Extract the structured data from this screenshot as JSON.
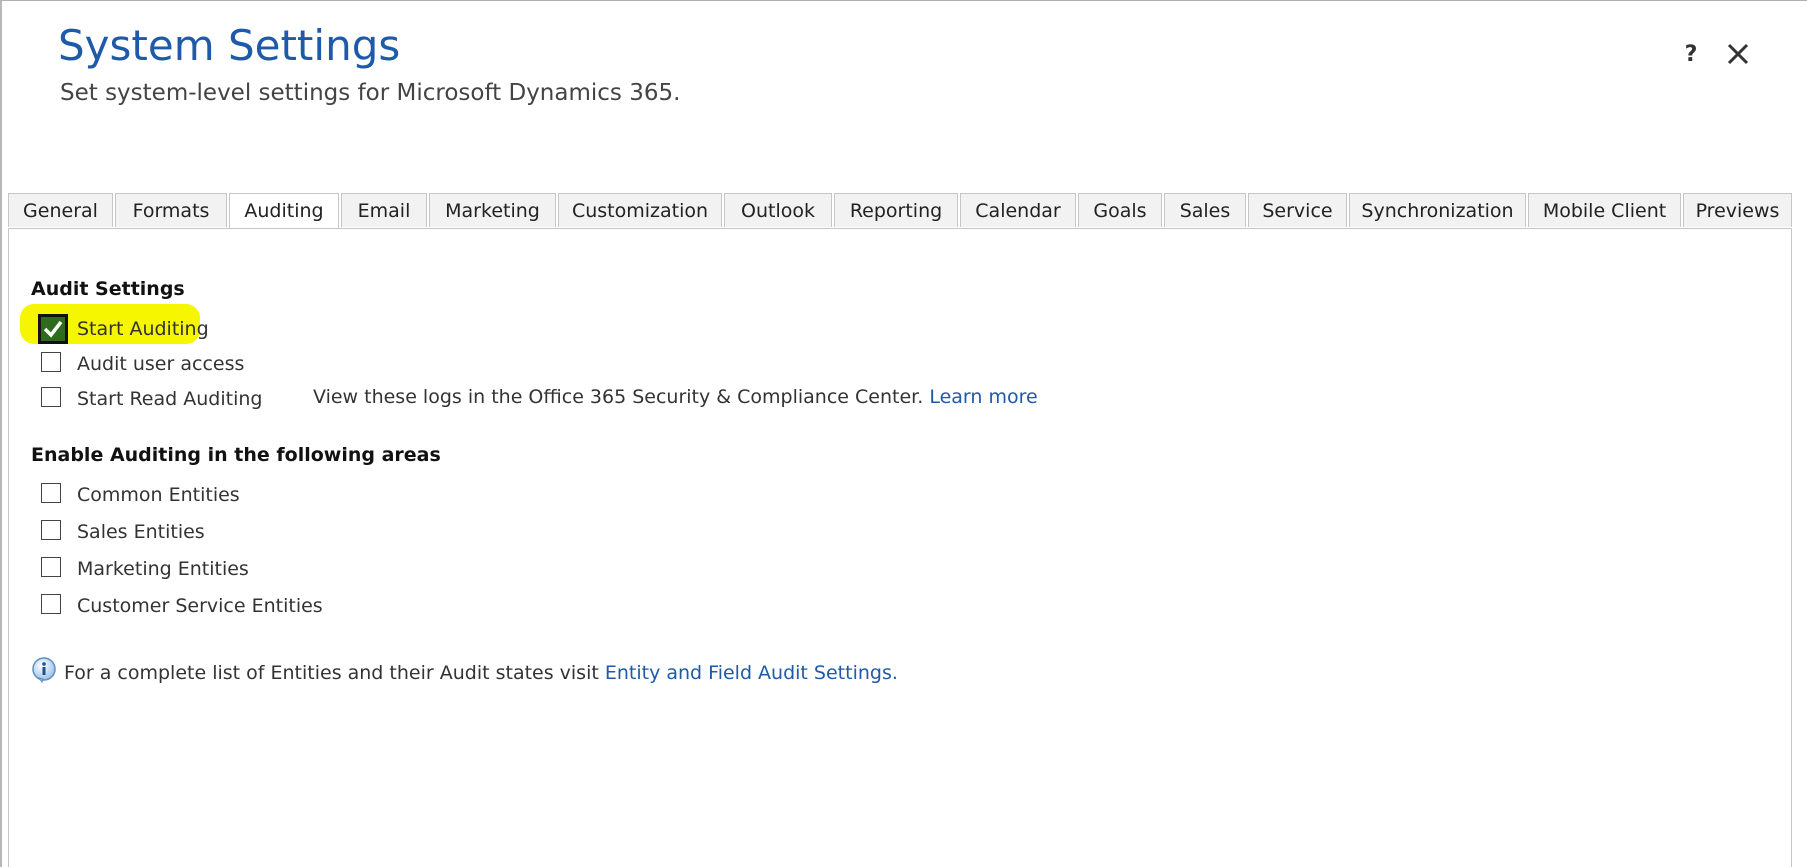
{
  "header": {
    "title": "System Settings",
    "subtitle": "Set system-level settings for Microsoft Dynamics 365.",
    "help_label": "?"
  },
  "tabs": [
    {
      "label": "General"
    },
    {
      "label": "Formats"
    },
    {
      "label": "Auditing",
      "active": true
    },
    {
      "label": "Email"
    },
    {
      "label": "Marketing"
    },
    {
      "label": "Customization"
    },
    {
      "label": "Outlook"
    },
    {
      "label": "Reporting"
    },
    {
      "label": "Calendar"
    },
    {
      "label": "Goals"
    },
    {
      "label": "Sales"
    },
    {
      "label": "Service"
    },
    {
      "label": "Synchronization"
    },
    {
      "label": "Mobile Client"
    },
    {
      "label": "Previews"
    }
  ],
  "audit_settings": {
    "heading": "Audit Settings",
    "start_auditing": {
      "label": "Start Auditing",
      "checked": true
    },
    "audit_user_access": {
      "label": "Audit user access",
      "checked": false
    },
    "start_read_auditing": {
      "label": "Start Read Auditing",
      "checked": false
    },
    "read_note": "View these logs in the Office 365 Security & Compliance Center.",
    "learn_more": "Learn more"
  },
  "areas": {
    "heading": "Enable Auditing in the following areas",
    "items": [
      {
        "label": "Common Entities",
        "checked": false
      },
      {
        "label": "Sales Entities",
        "checked": false
      },
      {
        "label": "Marketing Entities",
        "checked": false
      },
      {
        "label": "Customer Service Entities",
        "checked": false
      }
    ]
  },
  "info": {
    "text": "For a complete list of Entities and their Audit states visit",
    "link": "Entity and Field Audit Settings."
  },
  "colors": {
    "title_blue": "#1e5aa8",
    "link_blue": "#1e5aa8",
    "highlight_yellow": "#f6f600",
    "checked_green": "#2e6b1e"
  }
}
